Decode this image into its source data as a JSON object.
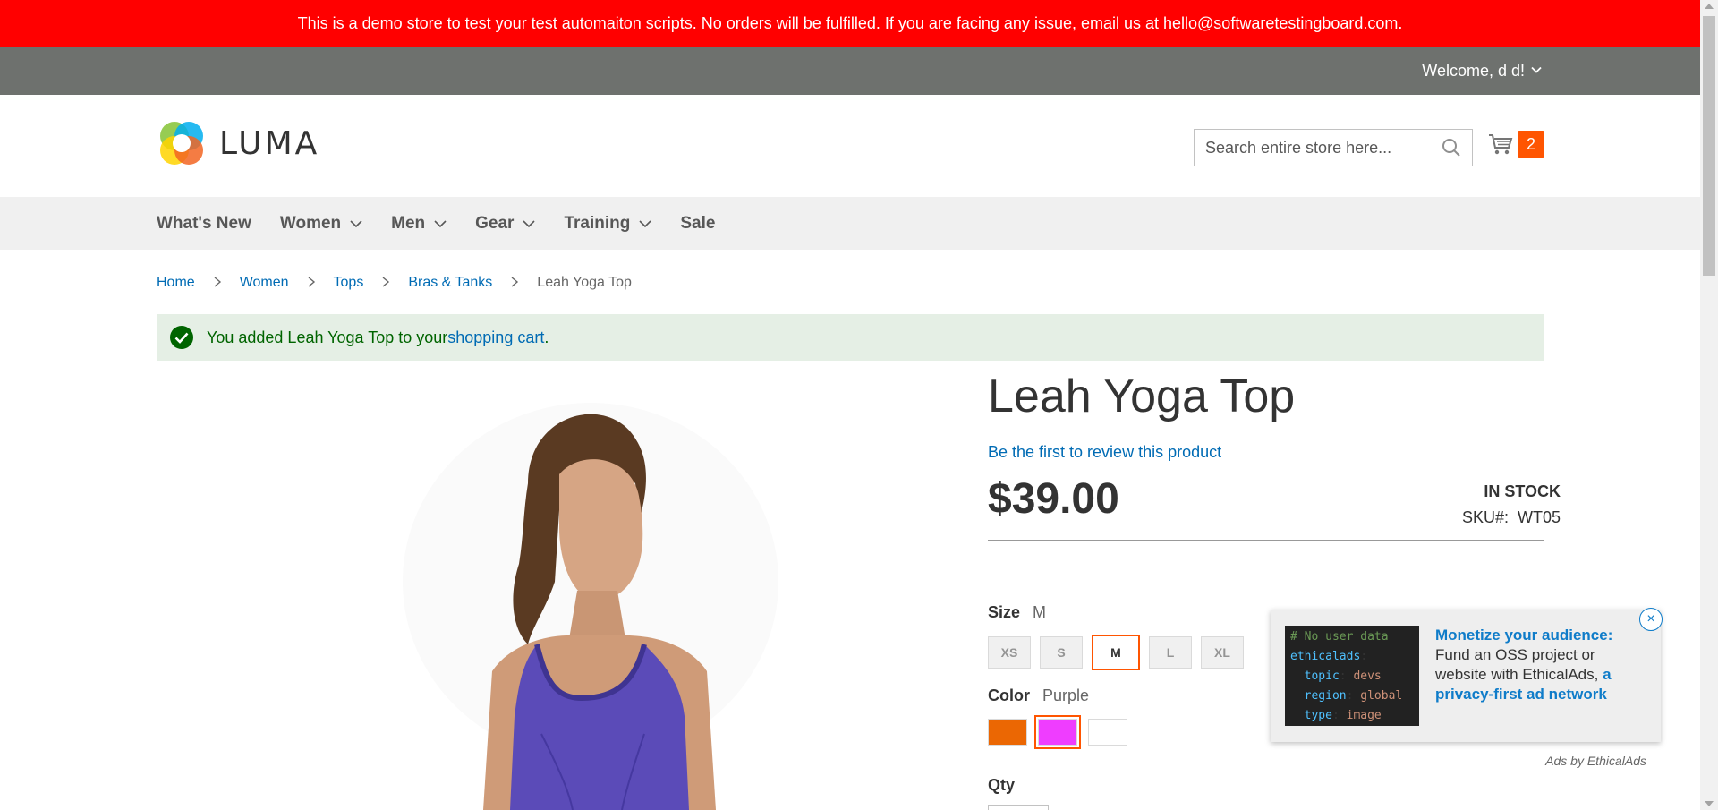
{
  "banner": {
    "text": "This is a demo store to test your test automaiton scripts. No orders will be fulfilled. If you are facing any issue, email us at hello@softwaretestingboard.com.",
    "bg_color": "#ff0000"
  },
  "panel": {
    "welcome": "Welcome, d d!"
  },
  "header": {
    "logo_text": "LUMA",
    "search_placeholder": "Search entire store here...",
    "search_value": "",
    "cart_count": "2",
    "accent_color": "#ff5501"
  },
  "nav": {
    "items": [
      {
        "label": "What's New",
        "has_menu": false
      },
      {
        "label": "Women",
        "has_menu": true
      },
      {
        "label": "Men",
        "has_menu": true
      },
      {
        "label": "Gear",
        "has_menu": true
      },
      {
        "label": "Training",
        "has_menu": true
      },
      {
        "label": "Sale",
        "has_menu": false
      }
    ]
  },
  "breadcrumbs": {
    "items": [
      "Home",
      "Women",
      "Tops",
      "Bras & Tanks"
    ],
    "current": "Leah Yoga Top"
  },
  "message": {
    "prefix": "You added Leah Yoga Top to your ",
    "link": "shopping cart",
    "suffix": "."
  },
  "product": {
    "title": "Leah Yoga Top",
    "review_link": "Be the first to review this product",
    "price": "$39.00",
    "stock": "IN STOCK",
    "sku_label": "SKU#:",
    "sku_value": "WT05",
    "size_label": "Size",
    "size_selected": "M",
    "sizes": [
      "XS",
      "S",
      "M",
      "L",
      "XL"
    ],
    "color_label": "Color",
    "color_selected": "Purple",
    "colors": [
      {
        "name": "Orange",
        "hex": "#eb6703"
      },
      {
        "name": "Purple",
        "hex": "#ef3dff"
      },
      {
        "name": "White",
        "hex": "#ffffff"
      }
    ],
    "qty_label": "Qty"
  },
  "ad": {
    "code_lines": [
      {
        "type": "comment",
        "text": "# No user data"
      },
      {
        "type": "key",
        "key": "ethicalads",
        "val": ""
      },
      {
        "type": "kv",
        "key": "topic",
        "val": "devs"
      },
      {
        "type": "kv",
        "key": "region",
        "val": "global"
      },
      {
        "type": "kv",
        "key": "type",
        "val": "image"
      }
    ],
    "headline": "Monetize your audience:",
    "body": "Fund an OSS project or website with EthicalAds,",
    "link": "a privacy-first ad network",
    "close": "×",
    "byline": "Ads by EthicalAds"
  }
}
